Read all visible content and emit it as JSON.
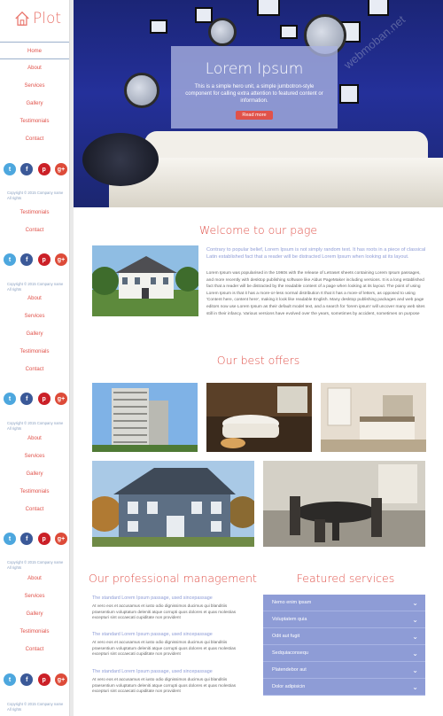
{
  "brand": {
    "name": "Plot"
  },
  "nav_groups": [
    [
      "Home",
      "About",
      "Services",
      "Gallery",
      "Testimonials",
      "Contact"
    ],
    [
      "Testimonials",
      "Contact"
    ],
    [
      "About",
      "Services",
      "Gallery",
      "Testimonials",
      "Contact"
    ],
    [
      "About",
      "Services",
      "Gallery",
      "Testimonials",
      "Contact"
    ],
    [
      "About",
      "Services",
      "Gallery",
      "Testimonials",
      "Contact"
    ]
  ],
  "social": [
    "t",
    "f",
    "p",
    "g+"
  ],
  "copyright": "Copyright © 2015 Company name All rights",
  "hero": {
    "title": "Lorem Ipsum",
    "text": "This is a simple hero unit, a simple jumbotron-style component for calling extra attention to featured content or information.",
    "button": "Read more"
  },
  "welcome": {
    "title": "Welcome to our page",
    "lead": "Contrary to popular belief, Lorem Ipsum is not simply random text. It has roots in a piece of classical Latin established fact that a reader will be distracted Lorem Ipsum when looking at its layout.",
    "body": "Lorem Ipsum was popularised in the 1960s with the release of Letraset sheets containing Lorem Ipsum passages, and more recently with desktop publishing software like Aldus PageMaker including versions. It is a long established fact that a reader will be distracted by the readable content of a page when looking at its layout. The point of using Lorem Ipsum is that it has a more-or-less normal distribution It that it has a more-of letters, as opposed to using 'Content here, content here', making it look like readable English. Many desktop publishing packages and web page editors now use Lorem Ipsum as their default model text, and a search for 'lorem ipsum' will uncover many web sites still in their infancy. Various versions have evolved over the years, sometimes by accident, sometimes on purpose"
  },
  "offers": {
    "title": "Our best offers"
  },
  "management": {
    "title": "Our professional management",
    "items": [
      {
        "link": "The standard Lorem Ipsum passage, used sincepassage",
        "text": "At vero eos et accusamus et iusto odio dignissimos ducimus qui blanditiis praesentium voluptatum deleniti atque corrupti quos dolores et quas molestias excepturi sint occaecati cupiditate non provident"
      },
      {
        "link": "The standard Lorem Ipsum passage, used sincepassage",
        "text": "At vero eos et accusamus et iusto odio dignissimos ducimus qui blanditiis praesentium voluptatum deleniti atque corrupti quos dolores et quas molestias excepturi sint occaecati cupiditate non provident"
      },
      {
        "link": "The standard Lorem Ipsum passage, used sincepassage",
        "text": "At vero eos et accusamus et iusto odio dignissimos ducimus qui blanditiis praesentium voluptatum deleniti atque corrupti quos dolores et quas molestias excepturi sint occaecati cupiditate non provident"
      }
    ]
  },
  "featured": {
    "title": "Featured services",
    "items": [
      "Nemo enim ipsam",
      "Voluptatem quia",
      "Odit aut fugit",
      "Sedquiaconsequ",
      "Platendebor aut",
      "Dolor adipisicin"
    ]
  },
  "watermark": "webmoban.net"
}
